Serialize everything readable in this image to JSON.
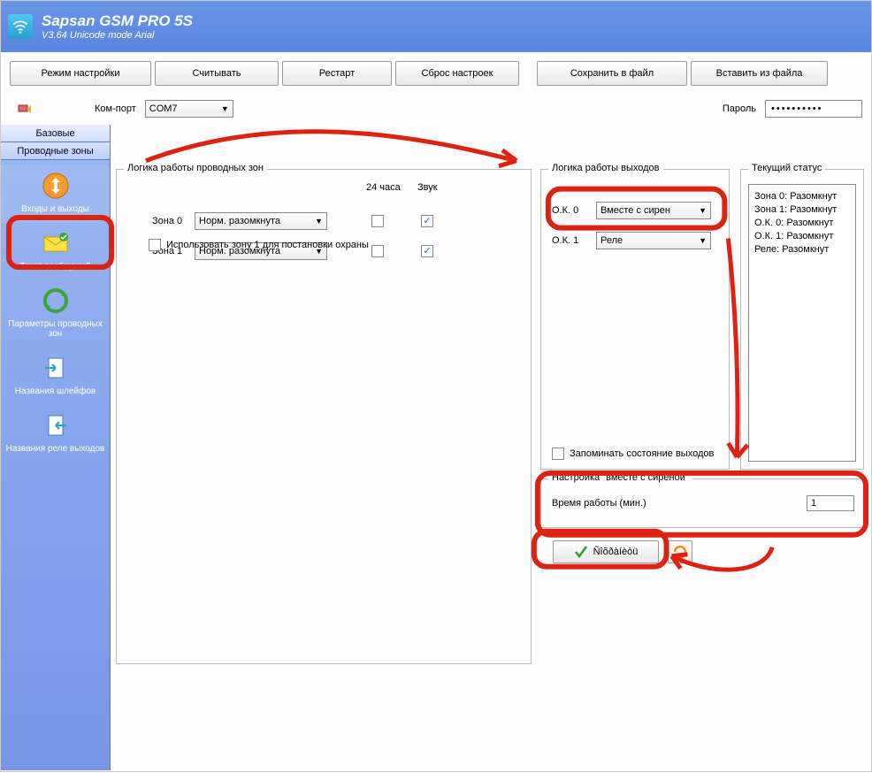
{
  "title": {
    "main": "Sapsan GSM PRO 5S",
    "sub": "V3.64 Unicode mode  Arial"
  },
  "toolbar": {
    "mode": "Режим настройки",
    "read": "Считывать",
    "restart": "Рестарт",
    "reset": "Сброс настроек",
    "saveFile": "Сохранить в файл",
    "loadFile": "Вставить из файла"
  },
  "port": {
    "label": "Ком-порт",
    "value": "COM7",
    "pwlabel": "Пароль",
    "pwvalue": "••••••••••"
  },
  "sideTabs": {
    "base": "Базовые",
    "wired": "Проводные зоны"
  },
  "sideItems": {
    "inout": "Входы и выходы",
    "textmsg": "Текст сообщений",
    "zoneparams": "Параметры проводных зон",
    "loopnames": "Названия шлейфов",
    "relaynames": "Названия реле выходов"
  },
  "zones": {
    "title": "Логика работы проводных зон",
    "col24": "24 часа",
    "colsnd": "Звук",
    "rows": [
      {
        "label": "Зона 0",
        "mode": "Норм. разомкнута",
        "h24": false,
        "snd": true
      },
      {
        "label": "Зона 1",
        "mode": "Норм. разомкнута",
        "h24": false,
        "snd": true
      }
    ],
    "useZone1": "Использовать зону 1 для постановки охраны",
    "useZone1Checked": false
  },
  "outputs": {
    "title": "Логика работы выходов",
    "rows": [
      {
        "label": "О.К. 0",
        "mode": "Вместе с сирен"
      },
      {
        "label": "О.К. 1",
        "mode": "Реле"
      }
    ],
    "remember": "Запоминать состояние выходов",
    "rememberChecked": false
  },
  "status": {
    "title": "Текущий статус",
    "l0": "Зона 0: Разомкнут",
    "l1": "Зона 1: Разомкнут",
    "blank": "",
    "l2": "О.К. 0: Разомкнут",
    "l3": "О.К. 1: Разомкнут",
    "l4": "Реле: Разомкнут"
  },
  "siren": {
    "title": "Настройка \"вместе с сиреной\"",
    "label": "Время работы (мин.)",
    "value": "1"
  },
  "actions": {
    "save": "Ñîõðàíèòü"
  }
}
